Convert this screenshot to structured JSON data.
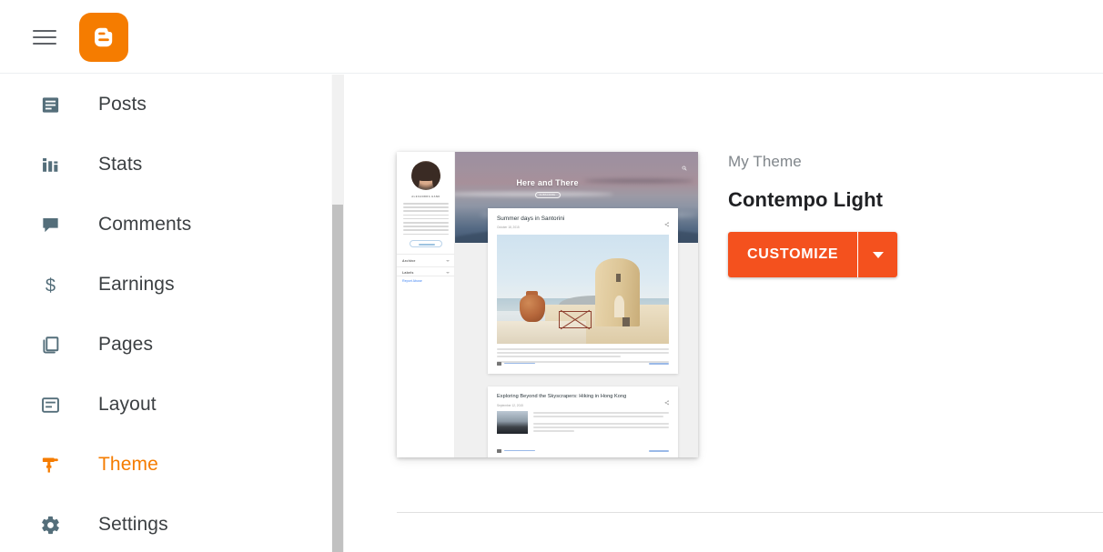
{
  "app": {
    "brand_name": "Blogger",
    "menu_icon": "hamburger-menu-icon",
    "logo_icon": "blogger-logo-icon",
    "accent_color": "#f57c00",
    "button_color": "#f4511e",
    "nav_icon_color": "#546e7a"
  },
  "sidebar": {
    "items": [
      {
        "label": "Posts",
        "icon": "posts-icon",
        "active": false
      },
      {
        "label": "Stats",
        "icon": "stats-icon",
        "active": false
      },
      {
        "label": "Comments",
        "icon": "comments-icon",
        "active": false
      },
      {
        "label": "Earnings",
        "icon": "earnings-icon",
        "active": false
      },
      {
        "label": "Pages",
        "icon": "pages-icon",
        "active": false
      },
      {
        "label": "Layout",
        "icon": "layout-icon",
        "active": false
      },
      {
        "label": "Theme",
        "icon": "theme-icon",
        "active": true
      },
      {
        "label": "Settings",
        "icon": "settings-icon",
        "active": false
      }
    ]
  },
  "main": {
    "theme_section": {
      "eyebrow": "My Theme",
      "theme_name": "Contempo Light",
      "customize_label": "CUSTOMIZE",
      "dropdown_icon": "chevron-down-icon"
    },
    "preview": {
      "blog_title": "Here and There",
      "subscribe_label": "SUBSCRIBE",
      "search_icon": "search-icon",
      "author_name": "ALEXANDRA HANK",
      "widgets": [
        {
          "label": "Archive"
        },
        {
          "label": "Labels"
        }
      ],
      "report_abuse": "Report Abuse",
      "posts": [
        {
          "title": "Summer days in Santorini",
          "date": "October 18, 2015",
          "share_icon": "share-icon",
          "comment_link": "Post a Comment",
          "read_more": "READ MORE"
        },
        {
          "title": "Exploring Beyond the Skyscrapers: Hiking in Hong Kong",
          "date": "September 12, 2015",
          "share_icon": "share-icon",
          "comment_link": "Post a Comment",
          "read_more": "READ MORE"
        }
      ]
    }
  }
}
